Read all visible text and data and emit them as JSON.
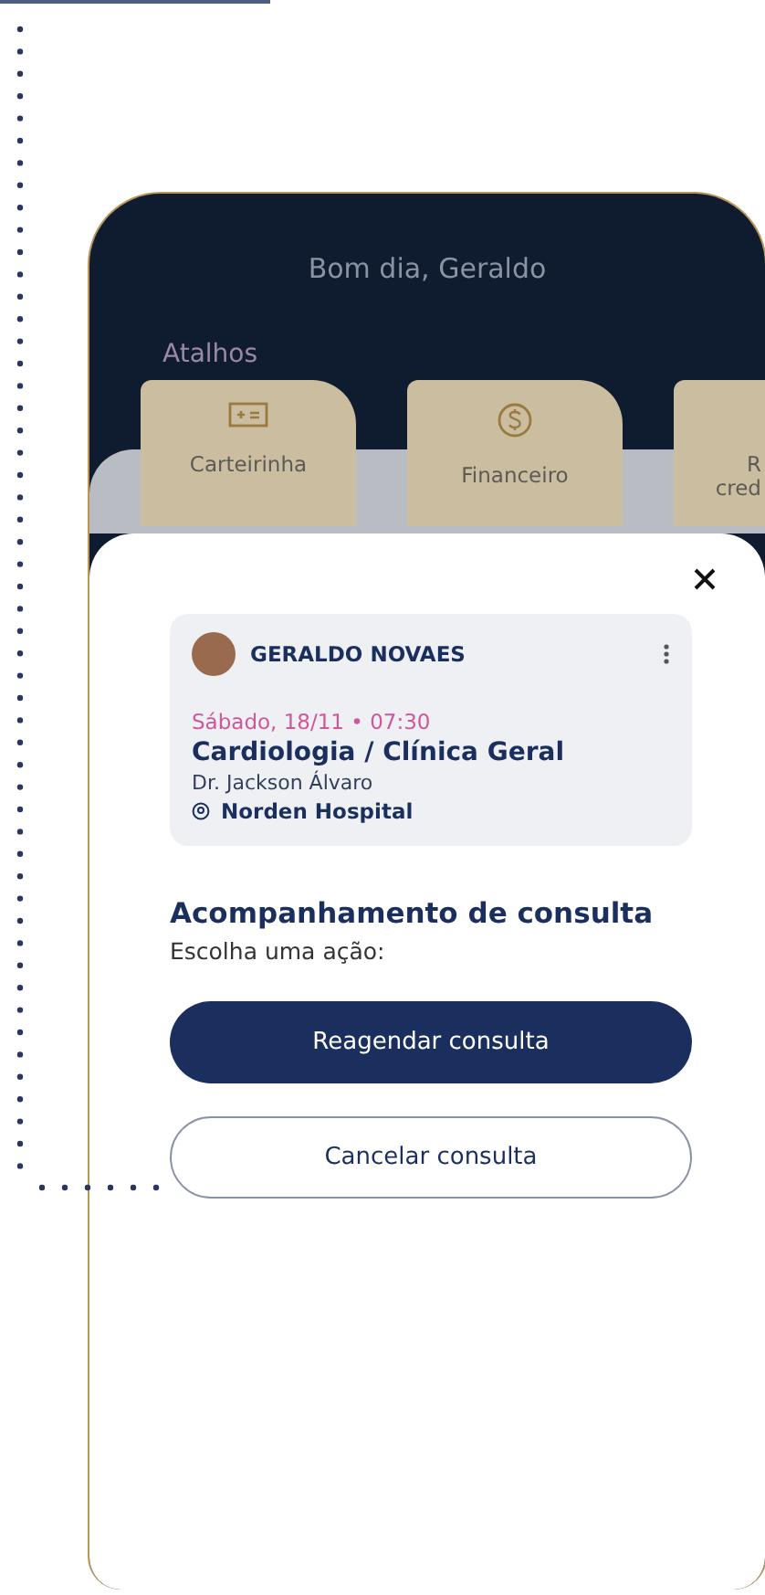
{
  "home": {
    "greeting": "Bom dia, Geraldo",
    "section_title": "Atalhos",
    "shortcuts": [
      {
        "label_lines": [
          "Carteirinha"
        ],
        "kind": "card"
      },
      {
        "label_lines": [
          "Financeiro"
        ],
        "kind": "dollar"
      },
      {
        "label_lines": [
          "R",
          "cred"
        ],
        "kind": "cut"
      }
    ]
  },
  "sheet": {
    "appointment": {
      "patient": "GERALDO NOVAES",
      "when": "Sábado, 18/11 • 07:30",
      "specialty": "Cardiologia / Clínica Geral",
      "doctor": "Dr. Jackson Álvaro",
      "location": "Norden Hospital"
    },
    "title": "Acompanhamento de consulta",
    "subtitle": "Escolha uma ação:",
    "actions": [
      {
        "label": "Reagendar consulta",
        "kind": "primary"
      },
      {
        "label": "Cancelar consulta",
        "kind": "secondary"
      }
    ]
  }
}
